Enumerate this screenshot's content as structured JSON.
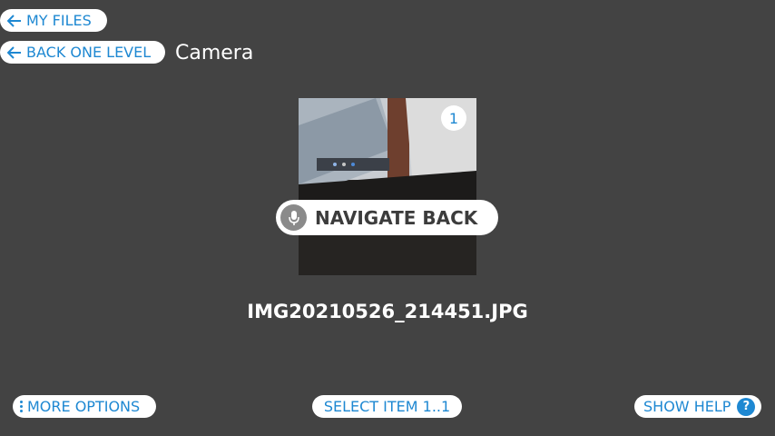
{
  "nav": {
    "my_files_label": "MY FILES",
    "back_one_level_label": "BACK ONE LEVEL"
  },
  "folder": {
    "title": "Camera"
  },
  "file": {
    "selection_number": "1",
    "name": "IMG20210526_214451.JPG",
    "thumbnail_icon": "photo-thumbnail"
  },
  "voice_prompt": {
    "label": "NAVIGATE BACK",
    "icon": "microphone-icon"
  },
  "footer": {
    "more_options_label": "MORE OPTIONS",
    "select_item_label": "SELECT ITEM 1..1",
    "show_help_label": "SHOW HELP",
    "help_glyph": "?"
  },
  "colors": {
    "background": "#434343",
    "accent": "#1e88d2",
    "pill": "#ffffff"
  }
}
